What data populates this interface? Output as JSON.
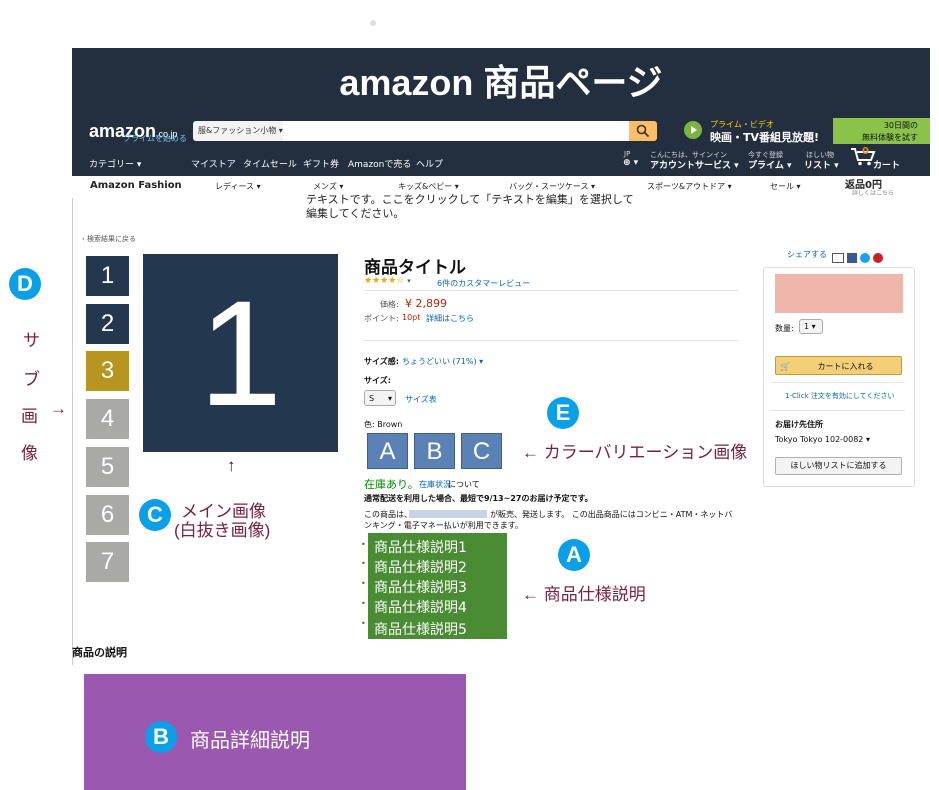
{
  "page_title": "amazon 商品ページ",
  "header": {
    "logo": "amazon",
    "logo_domain": ".co.jp",
    "logo_sub": "プライムを始める",
    "category_select": "服&ファッション小物",
    "prime_line1": "プライム・ビデオ",
    "prime_line2": "映画・TV番組見放題!",
    "trial_line1": "30日間の",
    "trial_line2": "無料体験を試す"
  },
  "nav": {
    "category": "カテゴリー",
    "items": [
      "マイストア",
      "タイムセール",
      "ギフト券",
      "Amazonで売る",
      "ヘルプ"
    ],
    "jp": "JP",
    "greeting": "こんにちは、サインイン",
    "account": "アカウントサービス",
    "register_top": "今すぐ登録",
    "prime": "プライム",
    "wish_top": "ほしい物",
    "wishlist": "リスト",
    "cart_count": "0",
    "cart": "カート"
  },
  "subnav": {
    "brand": "Amazon Fashion",
    "items": [
      "レディース",
      "メンズ",
      "キッズ&ベビー",
      "バッグ・スーツケース",
      "スポーツ&アウトドア",
      "セール"
    ],
    "returns": "返品0円",
    "returns_sub": "詳しくはこちら"
  },
  "placeholder_note": "テキストです。ここをクリックして「テキストを編集」を選択して編集してください。",
  "back_link": "‹ 検索結果に戻る",
  "share": "シェアする",
  "thumbnails": [
    "1",
    "2",
    "3",
    "4",
    "5",
    "6",
    "7"
  ],
  "main_image": "1",
  "product": {
    "title": "商品タイトル",
    "reviews": "6件のカスタマーレビュー",
    "price_label": "価格:",
    "price": "¥ 2,899",
    "points_label": "ポイント:",
    "points": "10pt",
    "points_link": "詳細はこちら",
    "size_fit_label": "サイズ感:",
    "size_fit": "ちょうどいい (71%)",
    "size_label": "サイズ:",
    "size_value": "S",
    "size_chart": "サイズ表",
    "color_label": "色: Brown",
    "colors": [
      "A",
      "B",
      "C"
    ],
    "stock": "在庫あり。",
    "stock_link": "在庫状況",
    "stock_suffix": "について",
    "delivery": "通常配送を利用した場合、最短で9/13~27のお届け予定です。",
    "seller_line1a": "この商品は、",
    "seller_line1b": "が販売、発送します。 この出品商品にはコンビニ・ATM・ネットバ",
    "seller_line2": "ンキング・電子マネー払いが利用できます。",
    "specs": [
      "商品仕様説明1",
      "商品仕様説明2",
      "商品仕様説明3",
      "商品仕様説明4",
      "商品仕様説明5"
    ]
  },
  "buybox": {
    "qty_label": "数量:",
    "qty": "1",
    "cart_button": "カートに入れる",
    "one_click": "1-Click 注文を有効にしてください",
    "ship_to_label": "お届け先住所",
    "ship_to": "Tokyo Tokyo 102-0082",
    "wishlist_button": "ほしい物リストに追加する"
  },
  "description_heading": "商品の説明",
  "annotations": {
    "D_badge": "D",
    "sub_image": [
      "サ",
      "ブ",
      "画",
      "像"
    ],
    "arrow_right": "→",
    "arrow_up": "↑",
    "C_badge": "C",
    "main_image_label1": "メイン画像",
    "main_image_label2": "(白抜き画像)",
    "E_badge": "E",
    "color_variation_label": "← カラーバリエーション画像",
    "A_badge": "A",
    "spec_label": "← 商品仕様説明",
    "B_badge": "B",
    "detail_label": "商品詳細説明"
  },
  "colors": {
    "header_bg": "#232f3e",
    "thumb_dark": "#23374f",
    "thumb_gold": "#b8951e",
    "thumb_gray": "#a9a9a6",
    "spec_green": "#4a8c34",
    "description_purple": "#9b58b0",
    "badge_blue": "#0aa0e8",
    "annotation_red": "#7a1f3d"
  }
}
